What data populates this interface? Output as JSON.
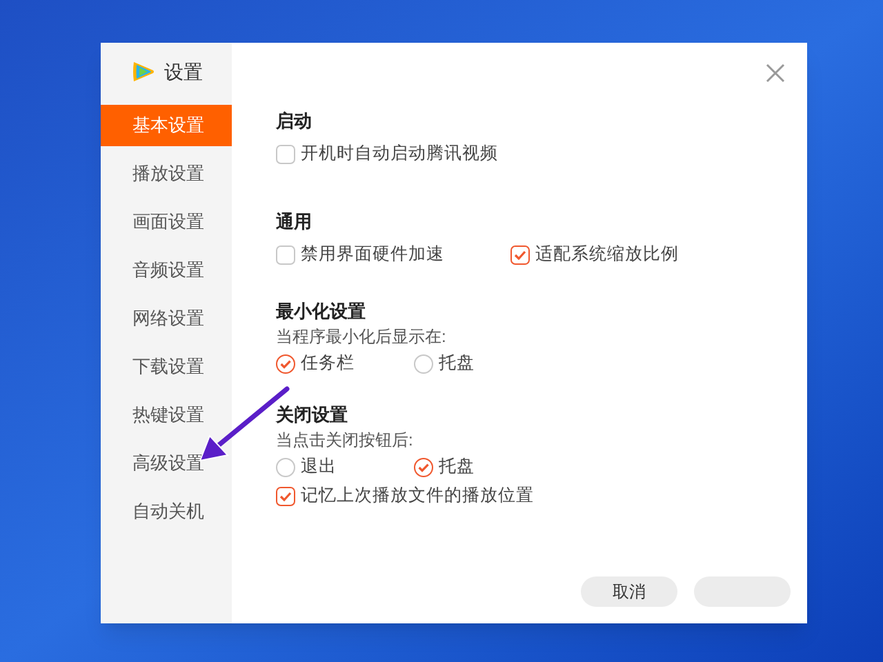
{
  "dialog": {
    "title": "设置"
  },
  "sidebar": {
    "items": [
      {
        "label": "基本设置",
        "selected": true
      },
      {
        "label": "播放设置",
        "selected": false
      },
      {
        "label": "画面设置",
        "selected": false
      },
      {
        "label": "音频设置",
        "selected": false
      },
      {
        "label": "网络设置",
        "selected": false
      },
      {
        "label": "下载设置",
        "selected": false
      },
      {
        "label": "热键设置",
        "selected": false
      },
      {
        "label": "高级设置",
        "selected": false
      },
      {
        "label": "自动关机",
        "selected": false
      }
    ]
  },
  "sections": [
    {
      "title": "启动",
      "rows": [
        [
          {
            "kind": "checkbox",
            "label": "开机时自动启动腾讯视频",
            "checked": false
          }
        ]
      ]
    },
    {
      "title": "通用",
      "rows": [
        [
          {
            "kind": "checkbox",
            "label": "禁用界面硬件加速",
            "checked": false
          },
          {
            "kind": "checkbox",
            "label": "适配系统缩放比例",
            "checked": true
          }
        ]
      ]
    },
    {
      "title": "最小化设置",
      "subtitle": "当程序最小化后显示在:",
      "rows": [
        [
          {
            "kind": "radio",
            "label": "任务栏",
            "checked": true
          },
          {
            "kind": "radio",
            "label": "托盘",
            "checked": false
          }
        ]
      ]
    },
    {
      "title": "关闭设置",
      "subtitle": "当点击关闭按钮后:",
      "rows": [
        [
          {
            "kind": "radio",
            "label": "退出",
            "checked": false
          },
          {
            "kind": "radio",
            "label": "托盘",
            "checked": true
          }
        ],
        [
          {
            "kind": "checkbox",
            "label": "记忆上次播放文件的播放位置",
            "checked": true
          }
        ]
      ]
    }
  ],
  "buttons": [
    {
      "kind": "labeled",
      "label": "取消"
    },
    {
      "kind": "obscured"
    }
  ]
}
